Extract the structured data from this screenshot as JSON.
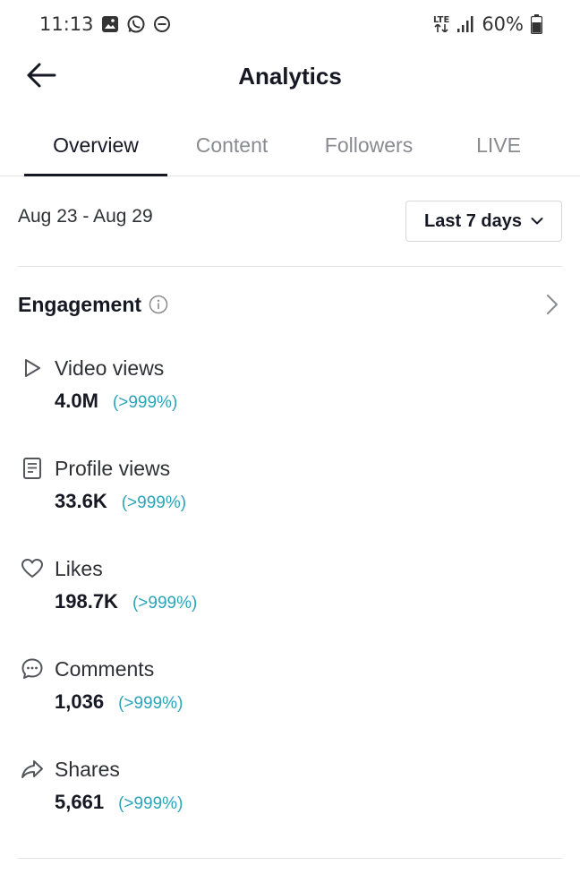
{
  "status_bar": {
    "time": "11:13",
    "network": "LTE",
    "battery": "60%"
  },
  "header": {
    "title": "Analytics"
  },
  "tabs": [
    {
      "label": "Overview",
      "active": true
    },
    {
      "label": "Content",
      "active": false
    },
    {
      "label": "Followers",
      "active": false
    },
    {
      "label": "LIVE",
      "active": false
    }
  ],
  "date_range": "Aug 23 - Aug 29",
  "period_select": {
    "selected": "Last 7 days"
  },
  "engagement": {
    "title": "Engagement",
    "metrics": [
      {
        "icon": "play-icon",
        "label": "Video views",
        "value": "4.0M",
        "change": "(>999%)"
      },
      {
        "icon": "profile-page-icon",
        "label": "Profile views",
        "value": "33.6K",
        "change": "(>999%)"
      },
      {
        "icon": "heart-icon",
        "label": "Likes",
        "value": "198.7K",
        "change": "(>999%)"
      },
      {
        "icon": "comment-icon",
        "label": "Comments",
        "value": "1,036",
        "change": "(>999%)"
      },
      {
        "icon": "share-icon",
        "label": "Shares",
        "value": "5,661",
        "change": "(>999%)"
      }
    ]
  },
  "colors": {
    "text_primary": "#161823",
    "text_secondary": "#8a8b91",
    "change_positive": "#2aa5b8",
    "divider": "#e3e3e4"
  }
}
